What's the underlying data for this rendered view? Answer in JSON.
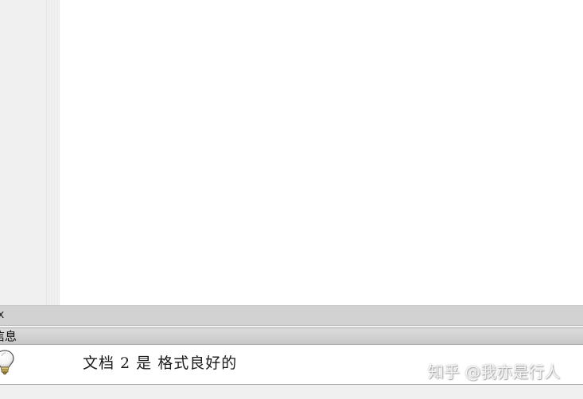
{
  "scrollbar": {
    "close_glyph": "x"
  },
  "panel": {
    "title": "信息",
    "message": "文档 2 是 格式良好的",
    "icon": "lightbulb-icon"
  },
  "watermark": {
    "text": "知乎 @我亦是行人"
  }
}
